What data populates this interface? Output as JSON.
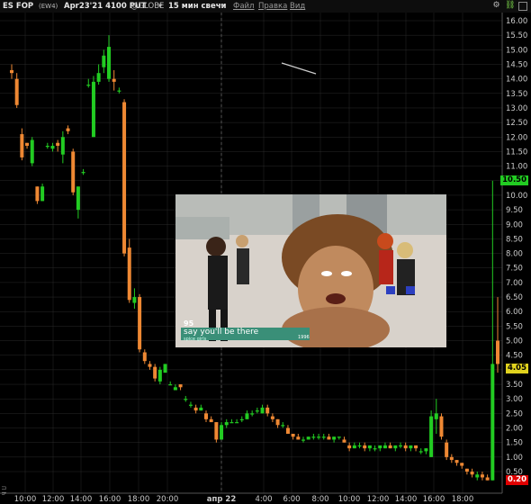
{
  "header": {
    "symbol": "ES FOP",
    "expiry_tag": "(EW4)",
    "contract": "Apr23'21 4100 PUT",
    "exchange": "@GLOBE",
    "interval": "15 мин свечи",
    "menu": [
      "Файл",
      "Правка",
      "Вид"
    ]
  },
  "price_axis": {
    "ticks": [
      "16.00",
      "15.50",
      "15.00",
      "14.50",
      "14.00",
      "13.50",
      "13.00",
      "12.50",
      "12.00",
      "11.50",
      "11.00",
      "10.50",
      "10.00",
      "9.50",
      "9.00",
      "8.50",
      "8.00",
      "7.50",
      "7.00",
      "6.50",
      "6.00",
      "5.50",
      "5.00",
      "4.50",
      "4.00",
      "3.50",
      "3.00",
      "2.50",
      "2.00",
      "1.50",
      "1.00",
      "0.50"
    ],
    "tags": [
      {
        "label": "10.50",
        "value": 10.5,
        "bg": "#22cc22",
        "fg": "#000"
      },
      {
        "label": "4.05",
        "value": 4.05,
        "bg": "#e0d21e",
        "fg": "#000"
      },
      {
        "label": "0.20",
        "value": 0.2,
        "bg": "#e00000",
        "fg": "#fff"
      }
    ]
  },
  "time_axis": {
    "labels": [
      "10:00",
      "12:00",
      "14:00",
      "16:00",
      "18:00",
      "20:00",
      "апр 22",
      "4:00",
      "6:00",
      "8:00",
      "10:00",
      "12:00",
      "14:00",
      "16:00",
      "18:00"
    ],
    "left_marker": "П h"
  },
  "video_overlay": {
    "channel_number": "95",
    "song_title": "say you'll be there",
    "artist": "spice girls",
    "year": "1996"
  },
  "colors": {
    "up": "#22cc22",
    "down": "#ee8833",
    "grid": "#2a2a2a",
    "axis_text": "#cccccc"
  },
  "chart_data": {
    "type": "candlestick",
    "ylim": [
      0,
      16.3
    ],
    "candles": [
      [
        14.3,
        14.2,
        14.5,
        14.0
      ],
      [
        14.0,
        13.1,
        14.2,
        13.0
      ],
      [
        12.1,
        11.3,
        12.3,
        11.2
      ],
      [
        11.8,
        11.7,
        11.8,
        11.6
      ],
      [
        11.1,
        11.9,
        12.0,
        11.0
      ],
      [
        10.3,
        9.8,
        10.3,
        9.7
      ],
      [
        9.8,
        10.3,
        10.4,
        9.8
      ],
      [
        11.7,
        11.7,
        11.8,
        11.6
      ],
      [
        11.6,
        11.7,
        11.8,
        11.5
      ],
      [
        11.8,
        11.7,
        11.9,
        11.5
      ],
      [
        11.4,
        12.0,
        12.2,
        11.1
      ],
      [
        12.3,
        12.2,
        12.4,
        12.1
      ],
      [
        11.5,
        10.1,
        11.6,
        10.0
      ],
      [
        9.5,
        10.3,
        10.3,
        9.2
      ],
      [
        10.8,
        10.8,
        10.9,
        10.7
      ],
      [
        13.8,
        13.8,
        14.0,
        13.7
      ],
      [
        12.0,
        13.9,
        14.1,
        12.0
      ],
      [
        13.9,
        14.2,
        14.5,
        13.8
      ],
      [
        14.4,
        14.8,
        15.0,
        14.2
      ],
      [
        14.0,
        15.1,
        15.5,
        13.9
      ],
      [
        14.0,
        13.9,
        14.3,
        13.6
      ],
      [
        13.6,
        13.6,
        13.7,
        13.5
      ],
      [
        13.2,
        8.0,
        13.3,
        7.9
      ],
      [
        8.2,
        6.4,
        8.5,
        6.3
      ],
      [
        6.3,
        6.5,
        6.8,
        6.1
      ],
      [
        6.5,
        4.7,
        6.6,
        4.6
      ],
      [
        4.6,
        4.3,
        4.7,
        4.2
      ],
      [
        4.2,
        4.1,
        4.3,
        4.0
      ],
      [
        4.1,
        3.7,
        4.2,
        3.6
      ],
      [
        3.6,
        4.0,
        4.1,
        3.5
      ],
      [
        3.9,
        4.2,
        4.2,
        3.9
      ],
      [
        3.5,
        3.5,
        3.6,
        3.5
      ],
      [
        3.3,
        3.4,
        3.5,
        3.3
      ],
      [
        3.5,
        3.4,
        3.5,
        3.3
      ],
      [
        3.0,
        3.0,
        3.1,
        2.9
      ],
      [
        2.8,
        2.8,
        2.9,
        2.7
      ],
      [
        2.7,
        2.6,
        2.8,
        2.5
      ],
      [
        2.6,
        2.7,
        2.8,
        2.6
      ],
      [
        2.5,
        2.3,
        2.6,
        2.2
      ],
      [
        2.3,
        2.2,
        2.4,
        2.2
      ],
      [
        2.2,
        1.6,
        2.2,
        1.5
      ],
      [
        1.6,
        2.1,
        2.2,
        1.6
      ],
      [
        2.1,
        2.2,
        2.3,
        2.0
      ],
      [
        2.2,
        2.2,
        2.3,
        2.2
      ],
      [
        2.2,
        2.2,
        2.3,
        2.2
      ],
      [
        2.3,
        2.3,
        2.4,
        2.2
      ],
      [
        2.3,
        2.5,
        2.6,
        2.3
      ],
      [
        2.5,
        2.5,
        2.6,
        2.4
      ],
      [
        2.6,
        2.6,
        2.7,
        2.5
      ],
      [
        2.5,
        2.7,
        2.8,
        2.5
      ],
      [
        2.7,
        2.5,
        2.8,
        2.4
      ],
      [
        2.4,
        2.3,
        2.5,
        2.2
      ],
      [
        2.3,
        2.1,
        2.3,
        2.0
      ],
      [
        2.1,
        2.1,
        2.2,
        2.0
      ],
      [
        2.0,
        1.8,
        2.1,
        1.8
      ],
      [
        1.8,
        1.7,
        1.8,
        1.6
      ],
      [
        1.7,
        1.6,
        1.8,
        1.6
      ],
      [
        1.6,
        1.6,
        1.7,
        1.5
      ],
      [
        1.6,
        1.7,
        1.7,
        1.6
      ],
      [
        1.7,
        1.7,
        1.8,
        1.6
      ],
      [
        1.7,
        1.7,
        1.8,
        1.6
      ],
      [
        1.7,
        1.7,
        1.8,
        1.6
      ],
      [
        1.7,
        1.6,
        1.8,
        1.6
      ],
      [
        1.6,
        1.7,
        1.7,
        1.5
      ],
      [
        1.7,
        1.7,
        1.7,
        1.6
      ],
      [
        1.6,
        1.5,
        1.7,
        1.5
      ],
      [
        1.4,
        1.3,
        1.5,
        1.2
      ],
      [
        1.3,
        1.4,
        1.5,
        1.3
      ],
      [
        1.4,
        1.4,
        1.5,
        1.3
      ],
      [
        1.4,
        1.3,
        1.5,
        1.2
      ],
      [
        1.3,
        1.4,
        1.4,
        1.2
      ],
      [
        1.3,
        1.3,
        1.4,
        1.2
      ],
      [
        1.3,
        1.4,
        1.4,
        1.2
      ],
      [
        1.3,
        1.4,
        1.5,
        1.3
      ],
      [
        1.4,
        1.3,
        1.5,
        1.3
      ],
      [
        1.3,
        1.4,
        1.4,
        1.2
      ],
      [
        1.4,
        1.4,
        1.5,
        1.3
      ],
      [
        1.4,
        1.3,
        1.5,
        1.2
      ],
      [
        1.3,
        1.4,
        1.4,
        1.2
      ],
      [
        1.4,
        1.3,
        1.4,
        1.2
      ],
      [
        1.2,
        1.2,
        1.3,
        1.1
      ],
      [
        1.2,
        1.3,
        1.3,
        1.1
      ],
      [
        1.0,
        2.4,
        2.6,
        1.0
      ],
      [
        2.3,
        2.5,
        3.0,
        1.8
      ],
      [
        2.4,
        1.7,
        2.5,
        1.6
      ],
      [
        1.5,
        1.0,
        1.6,
        0.9
      ],
      [
        1.0,
        0.9,
        1.1,
        0.8
      ],
      [
        0.9,
        0.8,
        0.9,
        0.7
      ],
      [
        0.8,
        0.7,
        0.8,
        0.6
      ],
      [
        0.6,
        0.5,
        0.6,
        0.4
      ],
      [
        0.5,
        0.4,
        0.6,
        0.3
      ],
      [
        0.3,
        0.4,
        0.5,
        0.2
      ],
      [
        0.4,
        0.3,
        0.5,
        0.2
      ],
      [
        0.3,
        0.2,
        0.4,
        0.2
      ],
      [
        0.2,
        4.2,
        10.5,
        0.2
      ],
      [
        5.0,
        4.2,
        6.5,
        3.9
      ]
    ]
  }
}
